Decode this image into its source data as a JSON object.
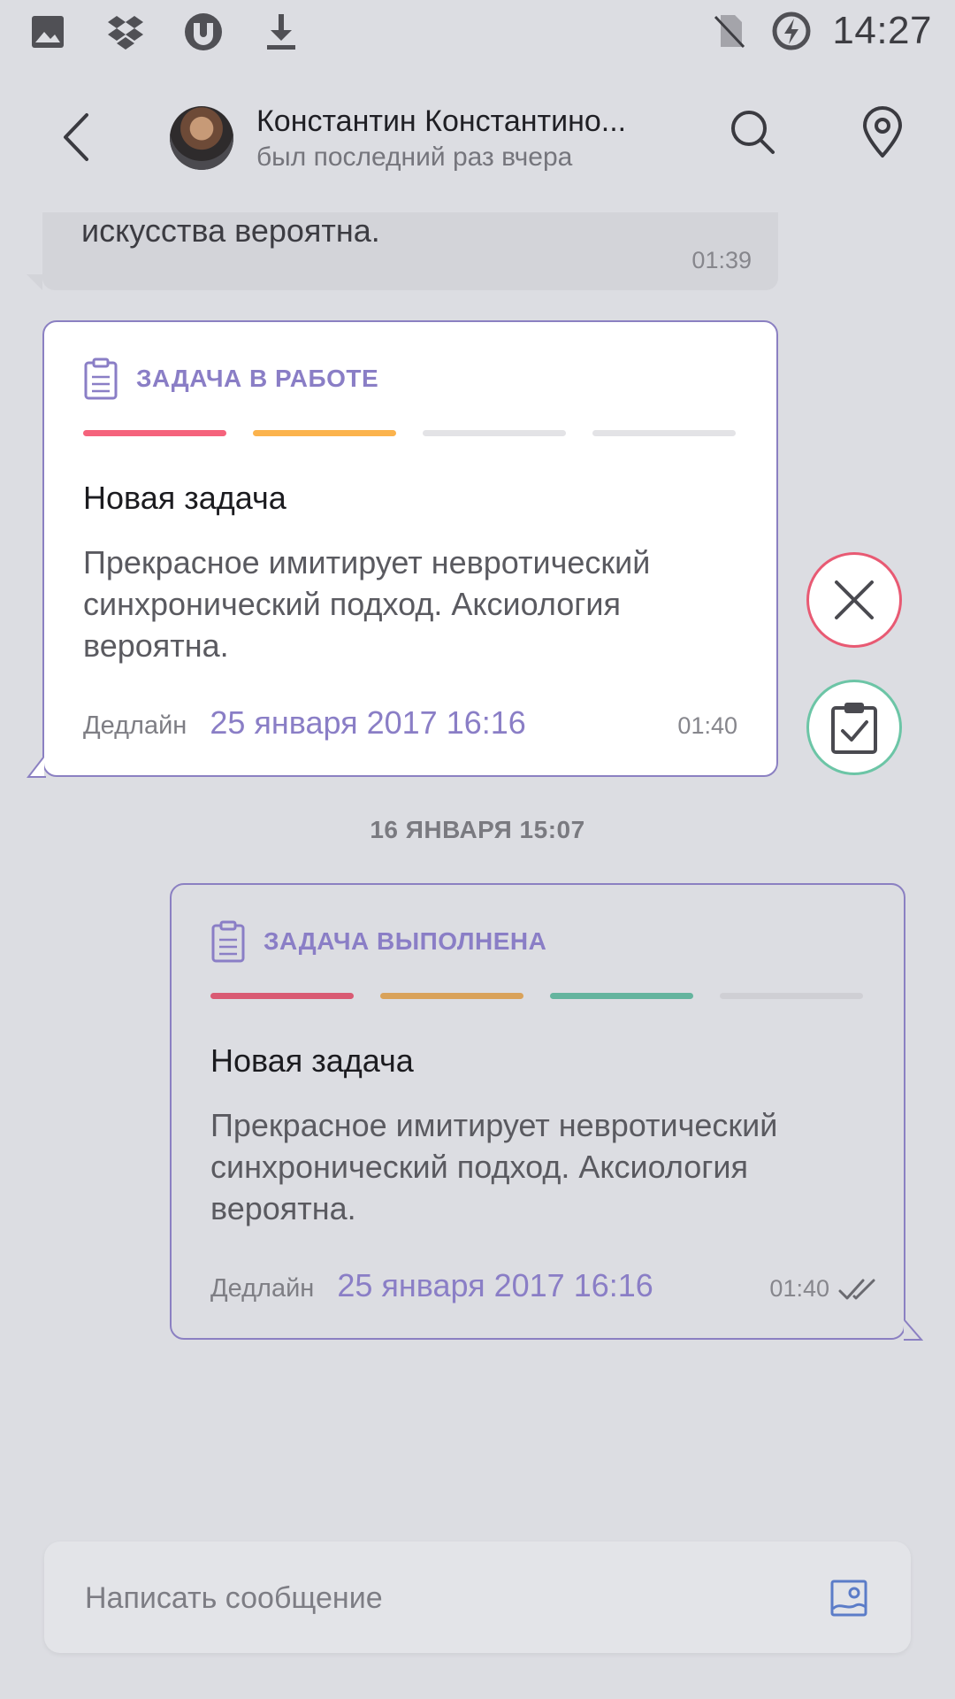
{
  "status_bar": {
    "time": "14:27",
    "icons": [
      "gallery-icon",
      "dropbox-icon",
      "utorrent-icon",
      "download-icon",
      "no-sim-icon",
      "battery-saver-icon"
    ]
  },
  "header": {
    "contact_name": "Константин Константино...",
    "contact_status": "был последний раз вчера",
    "icons": [
      "back-arrow-icon",
      "search-icon",
      "location-pin-icon"
    ]
  },
  "messages": {
    "previous": {
      "text": "искусства вероятна.",
      "time": "01:39"
    },
    "task_in_progress": {
      "status_label": "ЗАДАЧА В РАБОТЕ",
      "progress_colors": [
        "#f5637c",
        "#fbb34d",
        "#e3e3e6",
        "#e3e3e6"
      ],
      "progress_steps_done": 2,
      "progress_steps_total": 4,
      "title": "Новая задача",
      "description": "Прекрасное имитирует невротический синхронический подход. Аксиология вероятна.",
      "deadline_label": "Дедлайн",
      "deadline_value": "25 января 2017 16:16",
      "time": "01:40"
    },
    "date_divider": "16 ЯНВАРЯ 15:07",
    "task_done": {
      "status_label": "ЗАДАЧА ВЫПОЛНЕНА",
      "progress_colors": [
        "#d95a73",
        "#d9a25a",
        "#64b49e",
        "#cfcfd4"
      ],
      "progress_steps_done": 3,
      "progress_steps_total": 4,
      "title": "Новая задача",
      "description": "Прекрасное имитирует невротический синхронический подход. Аксиология вероятна.",
      "deadline_label": "Дедлайн",
      "deadline_value": "25 января 2017 16:16",
      "time": "01:40"
    }
  },
  "actions": {
    "reject_color": "#e85a73",
    "complete_color": "#6cc5a6"
  },
  "composer": {
    "placeholder": "Написать сообщение",
    "value": ""
  },
  "colors": {
    "accent": "#8a7ec6",
    "background": "#dcdde2"
  }
}
